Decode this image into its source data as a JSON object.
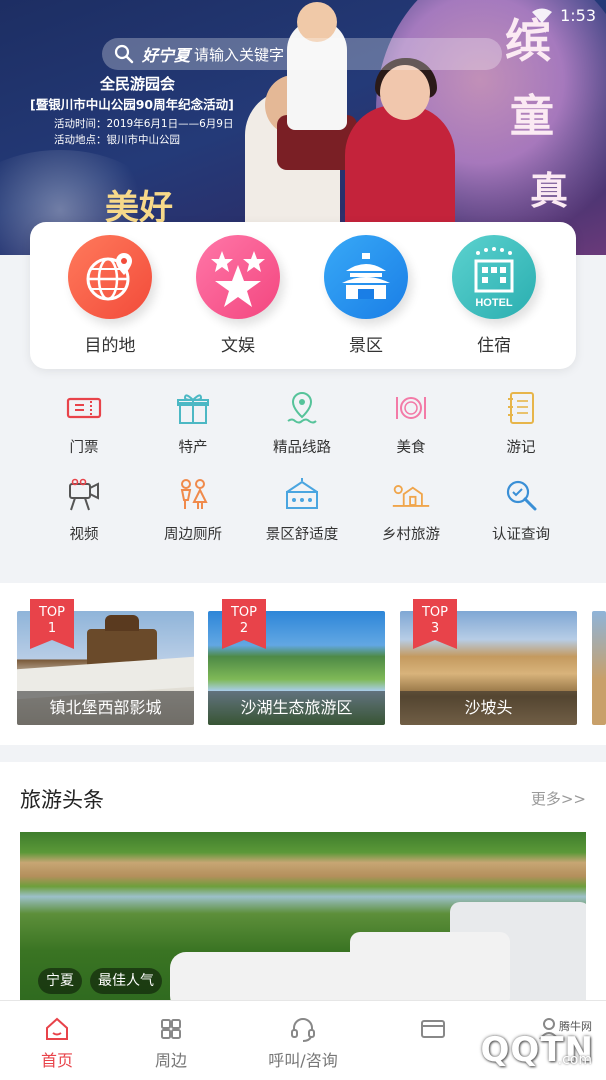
{
  "status_bar": {
    "time": "1:53"
  },
  "banner": {
    "brand_mark": "好宁夏",
    "search_placeholder": "请输入关键字",
    "event_title": "全民游园会",
    "event_subtitle": "[暨银川市中山公园90周年纪念活动]",
    "event_time": "活动时间：2019年6月1日——6月9日",
    "event_place": "活动地点：银川市中山公园",
    "big_chars": [
      "缤",
      "童",
      "真",
      "美好"
    ]
  },
  "main_categories": [
    {
      "label": "目的地",
      "icon": "globe-pin-icon",
      "color": "#f24b3a"
    },
    {
      "label": "文娱",
      "icon": "stars-icon",
      "color": "#f3467f"
    },
    {
      "label": "景区",
      "icon": "temple-icon",
      "color": "#1a7ee6"
    },
    {
      "label": "住宿",
      "icon": "hotel-icon",
      "color": "#2aaeb0"
    }
  ],
  "grid": [
    {
      "label": "门票",
      "icon": "ticket-icon"
    },
    {
      "label": "特产",
      "icon": "gift-icon"
    },
    {
      "label": "精品线路",
      "icon": "route-pin-icon"
    },
    {
      "label": "美食",
      "icon": "plate-icon"
    },
    {
      "label": "游记",
      "icon": "notebook-icon"
    },
    {
      "label": "视频",
      "icon": "camera-icon"
    },
    {
      "label": "周边厕所",
      "icon": "toilet-icon"
    },
    {
      "label": "景区舒适度",
      "icon": "comfort-icon"
    },
    {
      "label": "乡村旅游",
      "icon": "village-icon"
    },
    {
      "label": "认证查询",
      "icon": "search-verify-icon"
    }
  ],
  "top_list": [
    {
      "rank": "TOP",
      "num": "1",
      "name": "镇北堡西部影城"
    },
    {
      "rank": "TOP",
      "num": "2",
      "name": "沙湖生态旅游区"
    },
    {
      "rank": "TOP",
      "num": "3",
      "name": "沙坡头"
    }
  ],
  "news": {
    "title": "旅游头条",
    "more": "更多>>",
    "tags": [
      "宁夏",
      "最佳人气"
    ]
  },
  "tabbar": [
    {
      "label": "首页",
      "icon": "home-icon",
      "active": true
    },
    {
      "label": "周边",
      "icon": "grid-icon",
      "active": false
    },
    {
      "label": "呼叫/咨询",
      "icon": "headset-icon",
      "active": false
    },
    {
      "label": "",
      "icon": "card-icon",
      "active": false
    },
    {
      "label": "",
      "icon": "user-icon",
      "active": false
    }
  ],
  "watermark": {
    "top": "腾牛网",
    "main": "QQTN",
    "suffix": ".com"
  },
  "colors": {
    "accent": "#e8434a",
    "page_bg": "#f1f3f6"
  }
}
